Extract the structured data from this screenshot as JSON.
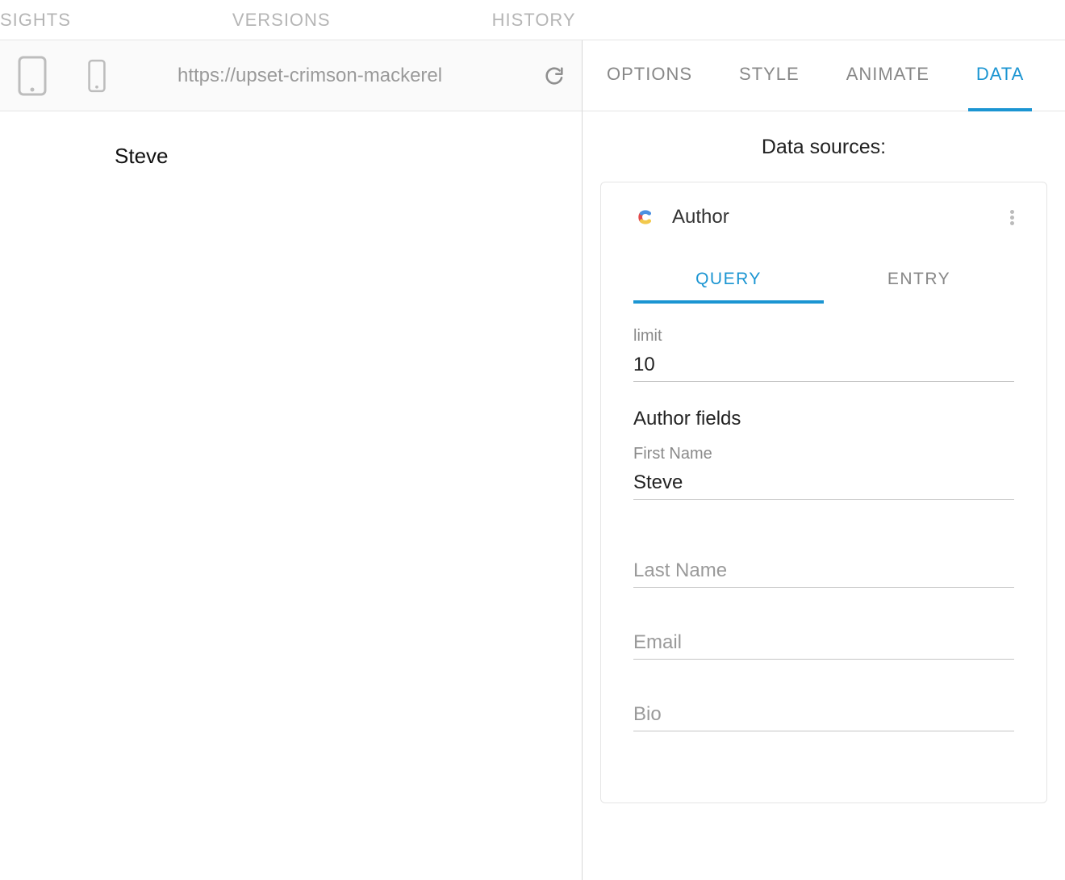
{
  "top_tabs": {
    "insights": "SIGHTS",
    "versions": "VERSIONS",
    "history": "HISTORY"
  },
  "url_bar": {
    "url": "https://upset-crimson-mackerel"
  },
  "preview": {
    "text": "Steve"
  },
  "right_tabs": {
    "options": "OPTIONS",
    "style": "STYLE",
    "animate": "ANIMATE",
    "data": "DATA",
    "active": "data"
  },
  "data_panel": {
    "title": "Data sources:",
    "source": {
      "name": "Author",
      "sub_tabs": {
        "query": "QUERY",
        "entry": "ENTRY",
        "active": "query"
      },
      "limit_label": "limit",
      "limit_value": "10",
      "fields_section": "Author fields",
      "fields": {
        "first_name": {
          "label": "First Name",
          "value": "Steve"
        },
        "last_name": {
          "placeholder": "Last Name",
          "value": ""
        },
        "email": {
          "placeholder": "Email",
          "value": ""
        },
        "bio": {
          "placeholder": "Bio",
          "value": ""
        }
      }
    }
  }
}
